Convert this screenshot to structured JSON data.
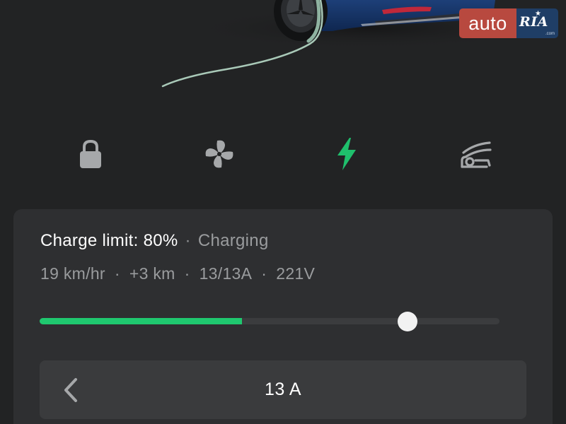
{
  "watermark": {
    "brand_left": "auto",
    "brand_right": "RIA",
    "brand_domain": ".com"
  },
  "car_image": {
    "description_icon": "car-photo",
    "cable_color": "#a9c9b8"
  },
  "controls": {
    "items": [
      {
        "name": "lock",
        "icon": "lock-icon",
        "active": false
      },
      {
        "name": "climate",
        "icon": "fan-icon",
        "active": false
      },
      {
        "name": "charging",
        "icon": "lightning-bolt-icon",
        "active": true
      },
      {
        "name": "frunk",
        "icon": "car-frunk-icon",
        "active": false
      }
    ],
    "active_color": "#1fbf6c",
    "inactive_color": "#a6a8aa"
  },
  "charge": {
    "limit_text": "Charge limit: 80%",
    "separator": "·",
    "state": "Charging",
    "rate": "19 km/hr",
    "added": "+3 km",
    "current": "13/13A",
    "voltage": "221V",
    "current_level_percent": 44,
    "limit_percent": 80,
    "fill_color": "#1fc86f"
  },
  "amperage": {
    "value": "13 A",
    "prev_icon": "chevron-left-icon"
  }
}
